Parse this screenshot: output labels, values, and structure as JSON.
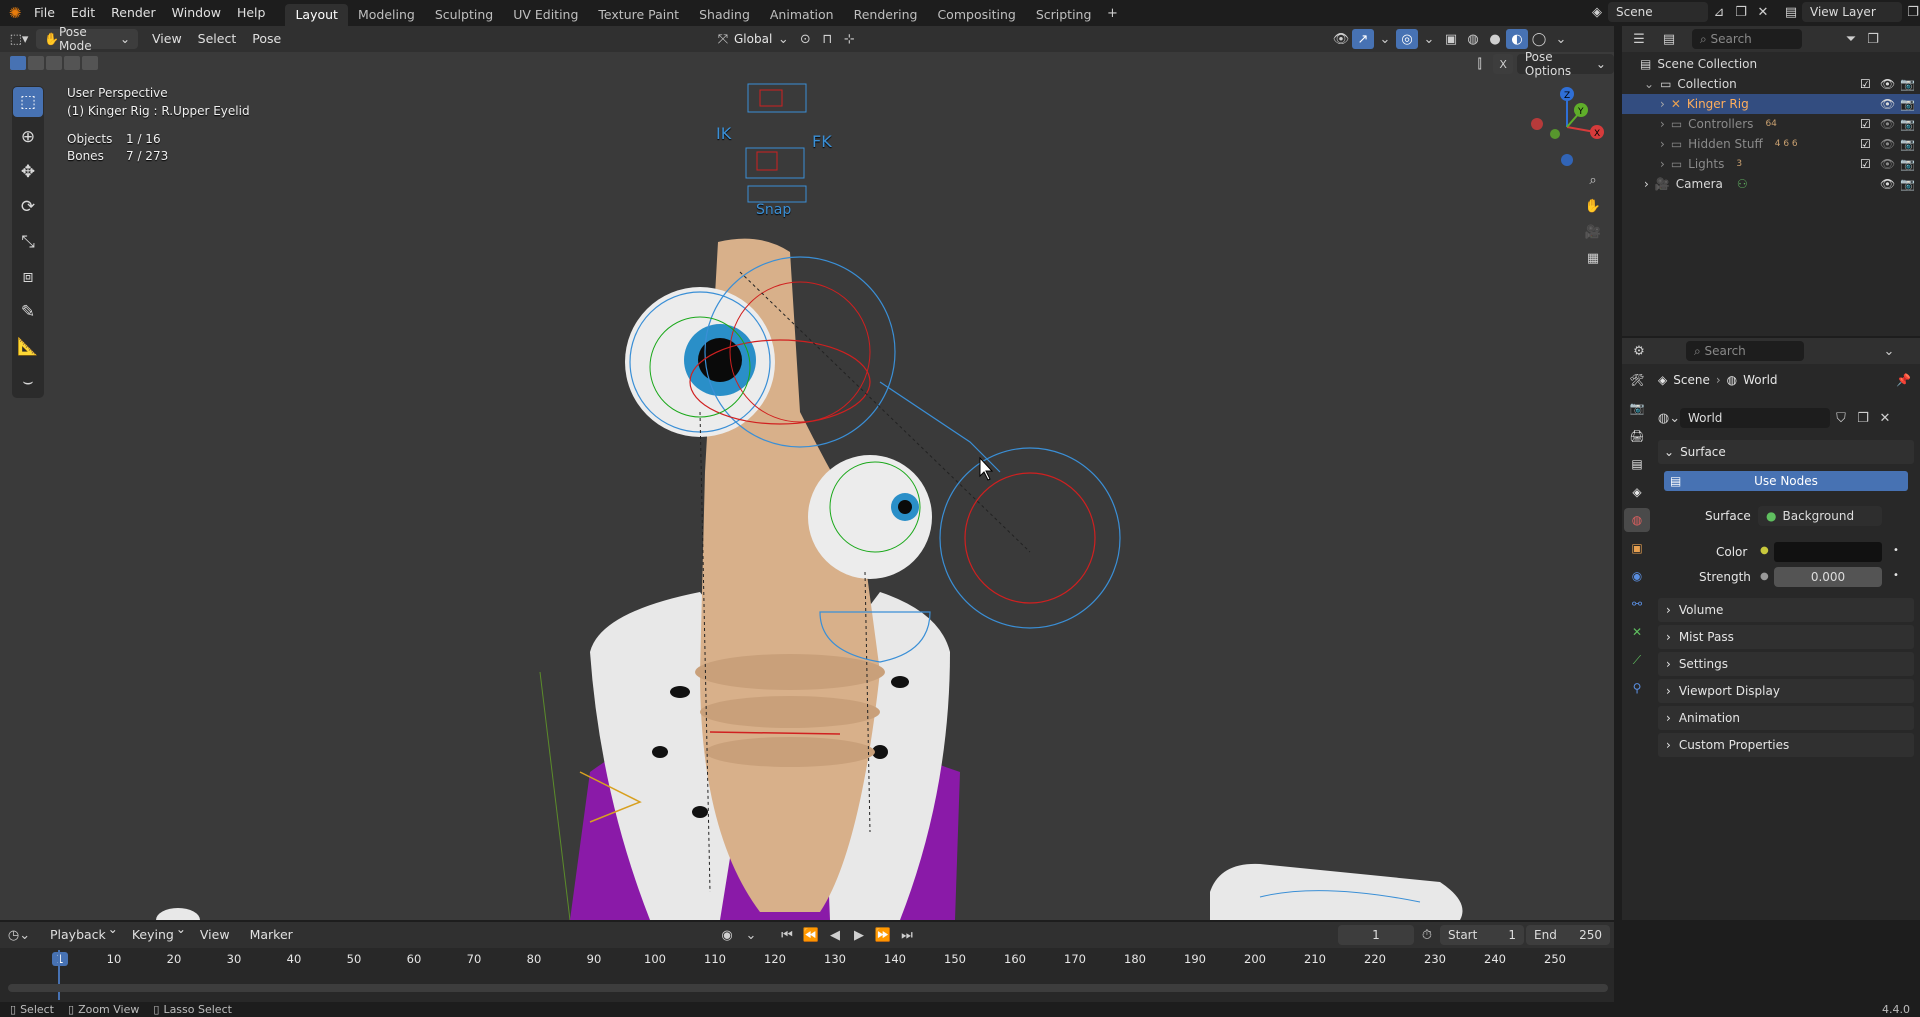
{
  "menus": [
    "File",
    "Edit",
    "Render",
    "Window",
    "Help"
  ],
  "workspaces": [
    "Layout",
    "Modeling",
    "Sculpting",
    "UV Editing",
    "Texture Paint",
    "Shading",
    "Animation",
    "Rendering",
    "Compositing",
    "Scripting"
  ],
  "active_workspace": "Layout",
  "scene_name": "Scene",
  "view_layer": "View Layer",
  "viewport_header": {
    "mode": "Pose Mode",
    "menus": [
      "View",
      "Select",
      "Pose"
    ],
    "transform_orientation": "Global",
    "pose_options": "Pose Options"
  },
  "viewport_overlay": {
    "view_name": "User Perspective",
    "active": "(1) Kinger Rig : R.Upper Eyelid",
    "objects_label": "Objects",
    "objects_value": "1 / 16",
    "bones_label": "Bones",
    "bones_value": "7 / 273",
    "rig_labels": [
      "IK",
      "FK",
      "Snap"
    ]
  },
  "outliner": {
    "search_placeholder": "Search",
    "root": "Scene Collection",
    "collection": "Collection",
    "items": [
      {
        "name": "Kinger Rig",
        "selected": true
      },
      {
        "name": "Controllers",
        "badge": "64",
        "dim": true
      },
      {
        "name": "Hidden Stuff",
        "badge": "4 6 6",
        "dim": true
      },
      {
        "name": "Lights",
        "badge": "3",
        "dim": true
      },
      {
        "name": "Camera",
        "dim": false
      }
    ]
  },
  "properties": {
    "search_placeholder": "Search",
    "breadcrumb_scene": "Scene",
    "breadcrumb_world": "World",
    "datablock": "World",
    "surface_panel": "Surface",
    "use_nodes": "Use Nodes",
    "surface_label": "Surface",
    "surface_value": "Background",
    "color_label": "Color",
    "strength_label": "Strength",
    "strength_value": "0.000",
    "panels": [
      "Volume",
      "Mist Pass",
      "Settings",
      "Viewport Display",
      "Animation",
      "Custom Properties"
    ]
  },
  "timeline": {
    "menus": [
      "Playback",
      "Keying",
      "View",
      "Marker"
    ],
    "current_frame": "1",
    "start_label": "Start",
    "start_value": "1",
    "end_label": "End",
    "end_value": "250",
    "ruler": [
      "1",
      "10",
      "20",
      "30",
      "40",
      "50",
      "60",
      "70",
      "80",
      "90",
      "100",
      "110",
      "120",
      "130",
      "140",
      "150",
      "160",
      "170",
      "180",
      "190",
      "200",
      "210",
      "220",
      "230",
      "240",
      "250"
    ]
  },
  "statusbar": {
    "select": "Select",
    "zoom": "Zoom View",
    "lasso": "Lasso Select",
    "version": "4.4.0"
  },
  "colors": {
    "accent": "#4772b3",
    "selection": "#334d80",
    "bone_blue": "#3a8fd6",
    "bone_red": "#d02020",
    "robe": "#8a1aa8",
    "skin": "#d8b08a"
  }
}
